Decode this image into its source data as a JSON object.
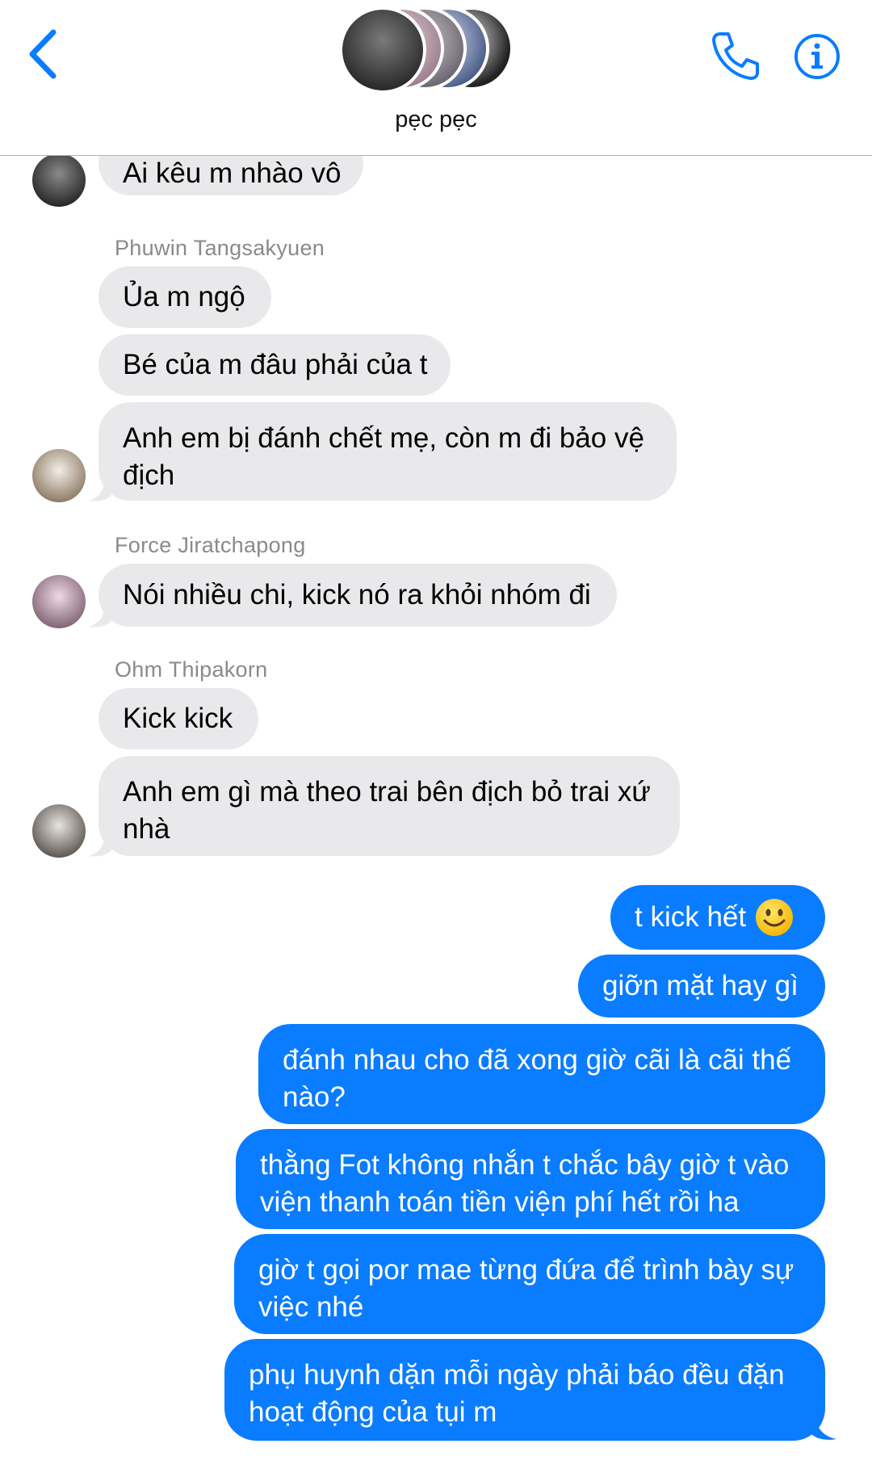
{
  "header": {
    "title": "pẹc pẹc",
    "back_icon": "chevron-left-icon",
    "call_icon": "phone-icon",
    "info_icon": "info-icon",
    "accent_color": "#0a7cff"
  },
  "messages": {
    "m0_text": "Ai kêu m nhào vô",
    "sender1": "Phuwin Tangsakyuen",
    "m1_text": "Ủa m ngộ",
    "m2_text": "Bé của m đâu phải của t",
    "m3_line1": "Anh em bị đánh chết mẹ, còn m đi bảo vệ",
    "m3_line2": "địch",
    "sender2": "Force Jiratchapong",
    "m4_text": "Nói nhiều chi, kick nó ra khỏi nhóm đi",
    "sender3": "Ohm Thipakorn",
    "m5_text": "Kick kick",
    "m6_line1": "Anh em gì mà theo trai bên địch bỏ trai xứ",
    "m6_line2": "nhà",
    "o1_text": "t kick hết",
    "o1_emoji": "slightly-smiling-face-icon",
    "o2_text": "giỡn mặt hay gì",
    "o3_line1": "đánh nhau cho đã xong giờ cãi là cãi thế",
    "o3_line2": "nào?",
    "o4_line1": "thằng Fot không nhắn t chắc bây giờ t vào",
    "o4_line2": "viện thanh toán tiền viện phí hết rồi ha",
    "o5_line1": "giờ t gọi por mae từng đứa để trình bày sự",
    "o5_line2": "việc nhé",
    "o6_line1": "phụ huynh dặn mỗi ngày phải báo đều đặn",
    "o6_line2": "hoạt động của tụi m"
  }
}
